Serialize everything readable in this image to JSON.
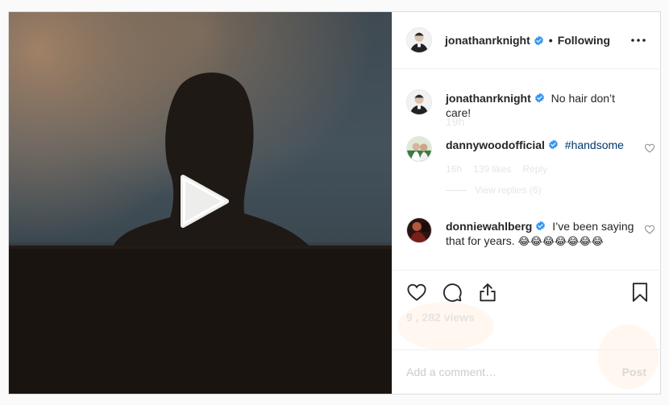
{
  "post": {
    "author": "jonathanrknight",
    "follow_separator": "•",
    "follow_status": "Following",
    "views_text": "9 , 282 views",
    "views_count": 9282
  },
  "comments": [
    {
      "user": "jonathanrknight",
      "verified": true,
      "text": "No hair don’t care!",
      "time": "19h",
      "is_caption": true
    },
    {
      "user": "dannywoodofficial",
      "verified": true,
      "text": "#handsome",
      "time": "16h",
      "likes": "139 likes",
      "reply": "Reply",
      "view_replies": "View replies (6)"
    },
    {
      "user": "donniewahlberg",
      "verified": true,
      "text": "I’ve been saying that for years.",
      "emojis": "😂😂😂😂😂😂😂"
    }
  ],
  "add_comment": {
    "placeholder": "Add a comment…",
    "post_label": "Post"
  },
  "icons": {
    "play": "play-icon",
    "more": "more-icon",
    "verified": "verified-badge-icon",
    "like": "heart-icon",
    "comment": "comment-icon",
    "share": "share-icon",
    "save": "bookmark-icon"
  },
  "colors": {
    "verified_blue": "#3897f0",
    "hashtag": "#00376b",
    "text": "#262626",
    "muted": "#8e8e8e"
  }
}
